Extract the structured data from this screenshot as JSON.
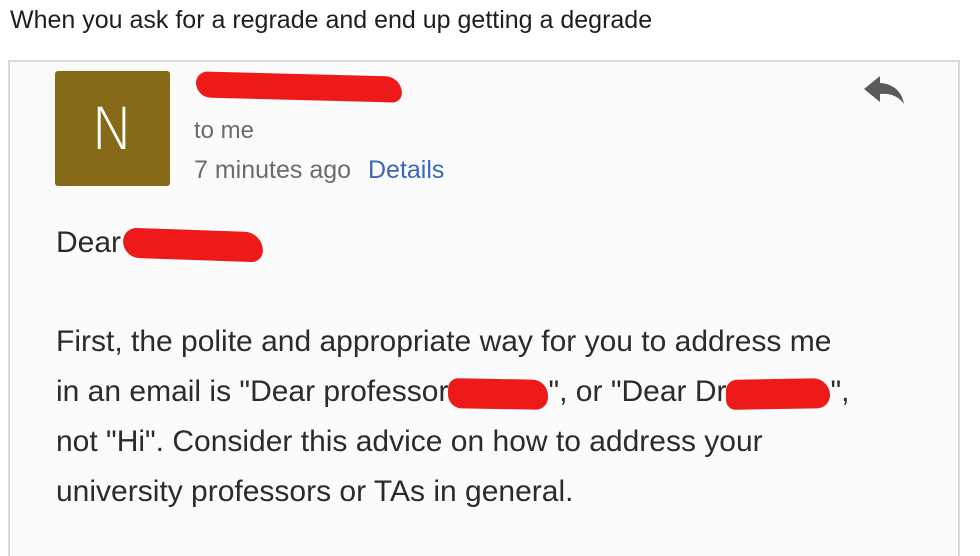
{
  "caption": "When you ask for a regrade and end up getting a degrade",
  "email": {
    "avatar_letter": "N",
    "avatar_color": "#876a18",
    "recipient": "to me",
    "time": "7 minutes ago",
    "details_link": "Details",
    "reply_icon": "reply-arrow-icon",
    "greeting": "Dear",
    "lines": {
      "l1": "First, the polite and appropriate way for you to address me",
      "l2a": "in an email is \"Dear professor",
      "l2b": "\", or \"Dear Dr",
      "l2c": "\",",
      "l3": "not \"Hi\". Consider this advice on how to address your",
      "l4": "university professors or TAs in general."
    },
    "redaction_color": "#ee1a1a"
  }
}
